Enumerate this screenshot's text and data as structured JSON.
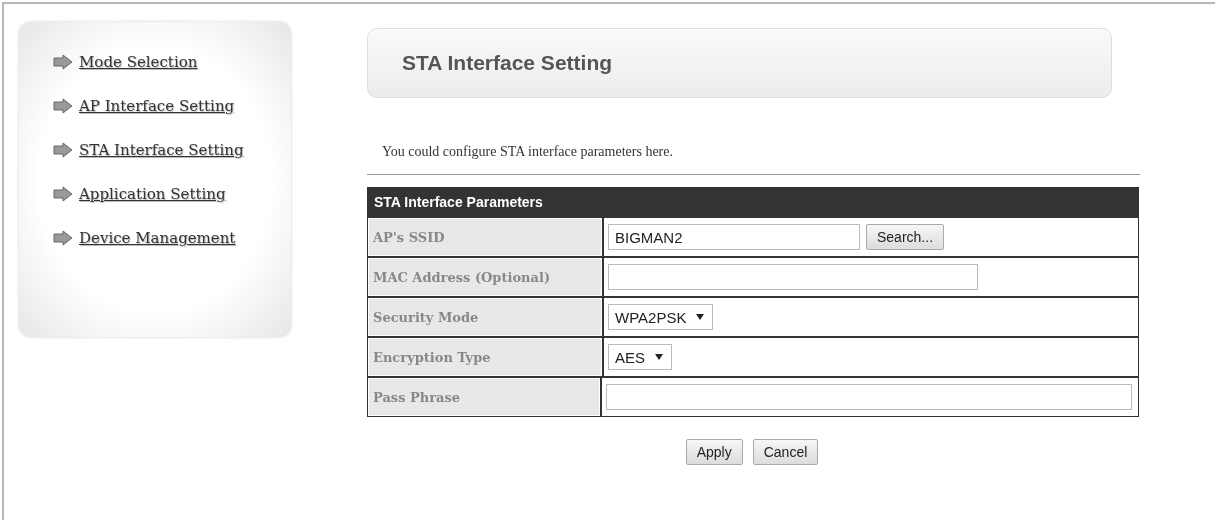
{
  "sidebar": {
    "items": [
      {
        "label": "Mode Selection"
      },
      {
        "label": "AP Interface Setting"
      },
      {
        "label": "STA Interface Setting"
      },
      {
        "label": "Application Setting"
      },
      {
        "label": "Device Management"
      }
    ]
  },
  "page_title": "STA Interface Setting",
  "description": "You could configure STA interface parameters here.",
  "table": {
    "heading": "STA Interface Parameters",
    "rows": [
      {
        "label": "AP's SSID",
        "kind": "text",
        "value": "BIGMAN2",
        "button": "Search..."
      },
      {
        "label": "MAC Address (Optional)",
        "kind": "text"
      },
      {
        "label": "Security Mode",
        "kind": "select",
        "value": "WPA2PSK"
      },
      {
        "label": "Encryption Type",
        "kind": "select",
        "value": "AES"
      },
      {
        "label": "Pass Phrase",
        "kind": "password"
      }
    ]
  },
  "buttons": [
    "Apply",
    "Cancel"
  ]
}
